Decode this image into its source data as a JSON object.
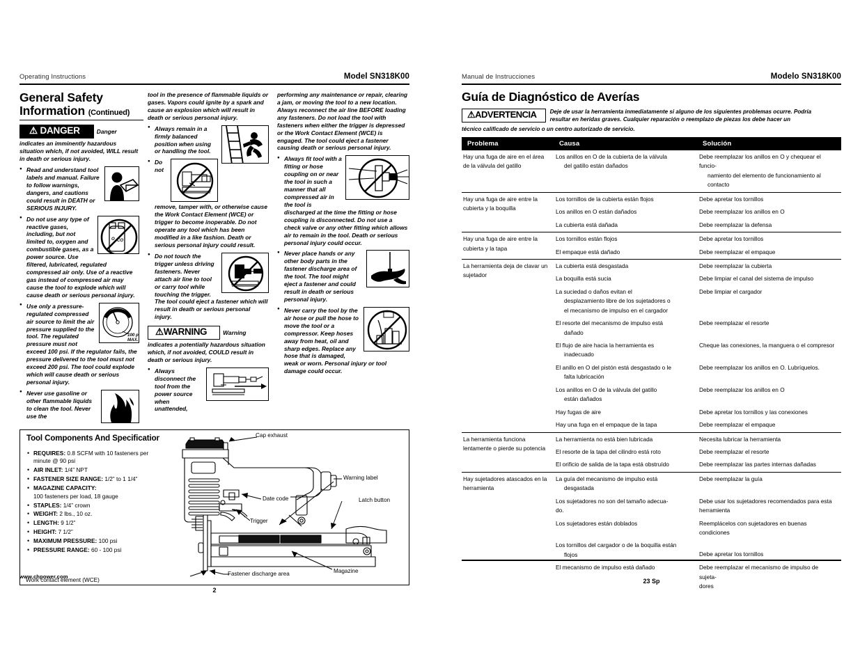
{
  "left_page": {
    "running_head_left": "Operating Instructions",
    "running_head_right": "Model SN318K00",
    "section_title": "General Safety Information",
    "section_title_continued": "(Continued)",
    "danger_badge": "⚠ DANGER",
    "danger_tail": "Danger",
    "danger_definition": "indicates an imminently hazardous situation which, if not avoided, WILL result in death or serious injury.",
    "warning_badge": "⚠WARNING",
    "warning_tail": "Warning",
    "warning_definition": "indicates  a potentially hazardous situation which, if not avoided, COULD result in death or serious injury.",
    "col1_bullets": [
      "Read and understand tool labels and manual. Failure to follow warnings, dangers, and cautions could result in DEATH or SERIOUS INJURY.",
      "Do not use any type of reactive gases, including, but not limited to, oxygen and combustible gases, as a power source. Use filtered, lubricated, regulated compressed air only. Use of a reactive gas instead of compressed air may cause the tool to explode which will cause death or serious personal injury.",
      "Use only a pressure-regulated compressed air source to limit the air pressure supplied to the tool. The regulated pressure must not exceed 100 psi. If the regulator fails, the pressure delivered to the tool must not exceed 200 psi. The tool could explode which will cause death or serious personal injury.",
      "Never use gasoline or other flammable liquids to clean the tool. Never use the"
    ],
    "col2_lead": "tool in the presence of flammable liquids or gases. Vapors could ignite by a spark and cause an explosion which will result in death or serious personal injury.",
    "col2_bullets": [
      "Always remain in a firmly balanced position when using or handling the tool.",
      "Do not remove, tamper with, or otherwise cause the Work Contact Element (WCE) or trigger to become inoperable. Do not operate any tool which has been modified in a like fashion. Death or serious personal injury could result.",
      "Do not touch the trigger unless driving fasteners. Never attach air line to tool or carry tool while touching the trigger. The tool could eject a fastener which will result in death or serious personal injury."
    ],
    "col2_after_warning_bullets": [
      "Always disconnect the tool from the power source when unattended,"
    ],
    "col3_lead": "performing any maintenance or repair, clearing a jam, or moving the tool to a new location. Always reconnect the air line BEFORE loading any fasteners. Do not load the tool with fasteners when either the trigger is depressed or the Work Contact Element (WCE) is engaged. The tool could eject a fastener causing death or serious personal injury.",
    "col3_bullets": [
      "Always fit tool with a fitting or hose coupling on or near the tool in such a manner that all compressed air in the tool is discharged at the time the fitting or hose coupling is disconnected. Do not use a check valve or any other fitting which allows air to remain in the tool. Death or serious personal injury could occur.",
      "Never place hands or any other body parts in the fastener discharge area of the tool. The tool might eject a fastener and could result in death or serious personal injury.",
      "Never carry the tool by the air hose or pull the hose to move the tool or a compressor. Keep hoses away from heat, oil and sharp edges. Replace any hose that is damaged, weak or worn. Personal injury or tool damage could occur."
    ],
    "figure_labels": {
      "cylinder_o2": "O",
      "cylinder_co2": "CO₂",
      "gauge_line1": "100 psi",
      "gauge_line2": "MAX."
    },
    "spec_box": {
      "heading": "Tool Components And Specifications",
      "items": [
        {
          "label": "REQUIRES:",
          "value": "0.8 SCFM with 10 fasteners per minute @ 90 psi"
        },
        {
          "label": "AIR INLET:",
          "value": "1/4” NPT"
        },
        {
          "label": "FASTENER SIZE RANGE:",
          "value": "1/2” to 1 1/4”"
        },
        {
          "label": "MAGAZINE CAPACITY:",
          "value": "100 fasteners per load, 18 gauge"
        },
        {
          "label": "STAPLES:",
          "value": "1/4” crown"
        },
        {
          "label": "WEIGHT:",
          "value": "2 lbs., 10 oz."
        },
        {
          "label": "LENGTH:",
          "value": "9 1/2”"
        },
        {
          "label": "HEIGHT:",
          "value": "7 1/2”"
        },
        {
          "label": "MAXIMUM PRESSURE:",
          "value": "100 psi"
        },
        {
          "label": "PRESSURE RANGE:",
          "value": "60 - 100 psi"
        }
      ],
      "callouts": {
        "cap_exhaust": "Cap exhaust",
        "warning_label": "Warning label",
        "latch_button": "Latch button",
        "date_code": "Date code",
        "trigger": "Trigger",
        "magazine": "Magazine",
        "fastener_discharge_area": "Fastener discharge area",
        "work_contact_element": "Work contact element (WCE)"
      }
    },
    "footer_url": "www.chpower.com",
    "footer_page": "2"
  },
  "right_page": {
    "running_head_left": "Manual de Instrucciones",
    "running_head_right": "Modelo SN318K00",
    "title": "Guía de Diagnóstico de Averías",
    "adv_badge": "⚠ADVERTENCIA",
    "adv_text_1": "Deje de usar la herramienta inmediatamente si alguno de los siguientes problemas ocurre. Podría resultar en heridas graves. Cualquier reparación o reemplazo de piezas los debe hacer un",
    "adv_text_2": "técnico calificado de servicio o un centro autorizado de servicio.",
    "table": {
      "headers": [
        "Problema",
        "Causa",
        "Solución"
      ],
      "groups": [
        {
          "problem": "Hay una fuga de aire en el área de la válvula del gatillo",
          "rows": [
            {
              "causa": "Los anillos en O de la cubierta de la válvula",
              "causa_ind": "del gatillo están dañados",
              "solucion": "Debe reemplazar los anillos en O y chequear el funcio-",
              "solucion_ind": "namiento del elemento de funcionamiento al contacto"
            }
          ]
        },
        {
          "problem": "Hay una fuga de aire entre la cubierta y la boquilla",
          "rows": [
            {
              "causa": "Los tornillos de la cubierta están flojos",
              "solucion": "Debe apretar los tornillos"
            },
            {
              "causa": "Los anillos en O están dañados",
              "solucion": "Debe reemplazar los anillos en O"
            },
            {
              "causa": "La cubierta está dañada",
              "solucion": "Debe reemplazar la defensa"
            }
          ]
        },
        {
          "problem": "Hay una fuga de aire entre la cubierta y la tapa",
          "rows": [
            {
              "causa": "Los tornillos están flojos",
              "solucion": "Debe apretar los tornillos"
            },
            {
              "causa": "El empaque está dañado",
              "solucion": "Debe reemplazar el empaque"
            }
          ]
        },
        {
          "problem": "La herramienta deja de clavar un sujetador",
          "rows": [
            {
              "causa": "La cubierta está desgastada",
              "solucion": "Debe reemplazar la cubierta"
            },
            {
              "causa": "La boquilla está sucia",
              "solucion": "Debe limpiar el canal del sistema de impulso"
            },
            {
              "causa": "La suciedad o daños evitan el",
              "causa_ind": "desplazamiento libre de los sujetadores o",
              "causa_ind2": "el mecanismo de impulso en el cargador",
              "solucion": "Debe limpiar el cargador"
            },
            {
              "causa": "El resorte del mecanismo de impulso está",
              "causa_ind": "dañado",
              "solucion": "Debe reemplazar el resorte"
            },
            {
              "causa": "El flujo de aire hacia la herramienta es",
              "causa_ind": "inadecuado",
              "solucion": "Cheque las conexiones, la manguera o el compresor"
            },
            {
              "causa": "El anillo en O del pistón está desgastado o le",
              "causa_ind": "falta lubricación",
              "solucion": "Debe reemplazar los anillos en O. Lubríquelos."
            },
            {
              "causa": "Los anillos en O de la válvula del gatillo",
              "causa_ind": "están dañados",
              "solucion": "Debe reemplazar los anillos en O"
            },
            {
              "causa": "Hay fugas de aire",
              "solucion": "Debe apretar los tornillos y las conexiones"
            },
            {
              "causa": "Hay una fuga en el empaque de la tapa",
              "solucion": "Debe reemplazar el empaque"
            }
          ]
        },
        {
          "problem": "La herramienta funciona lentamente o pierde su potencia",
          "rows": [
            {
              "causa": "La herramienta no está bien lubricada",
              "solucion": "Necesita lubricar la herramienta"
            },
            {
              "causa": "El resorte de la tapa del cilindro está roto",
              "solucion": "Debe reemplazar el resorte"
            },
            {
              "causa": "El orificio de salida de la tapa está obstruído",
              "solucion": "Debe reemplazar las partes internas dañadas"
            }
          ]
        },
        {
          "problem": "Hay sujetadores atascados en la herramienta",
          "rows": [
            {
              "causa": "La guía del mecanismo de impulso está",
              "causa_ind": "desgastada",
              "solucion": "Debe reemplazar la guía"
            },
            {
              "causa": "Los sujetadores no son del tamaño adecua-",
              "causa_ind": "do.",
              "solucion": "Debe usar los sujetadores recomendados para esta",
              "solucion_ind": "herramienta"
            },
            {
              "causa": "Los sujetadores están doblados",
              "solucion": "Reemplácelos con sujetadores en buenas condiciones"
            },
            {
              "causa": "Los tornillos del cargador o de la boquilla están",
              "causa_ind": "flojos",
              "solucion_gap": true,
              "solucion": "Debe apretar los tornillos"
            },
            {
              "causa": "El mecanismo de impulso está dañado",
              "solucion": "Debe reemplazar el mecanismo de impulso de sujeta-",
              "solucion_ind": "dores"
            }
          ]
        }
      ]
    },
    "footer_page": "23 Sp"
  }
}
